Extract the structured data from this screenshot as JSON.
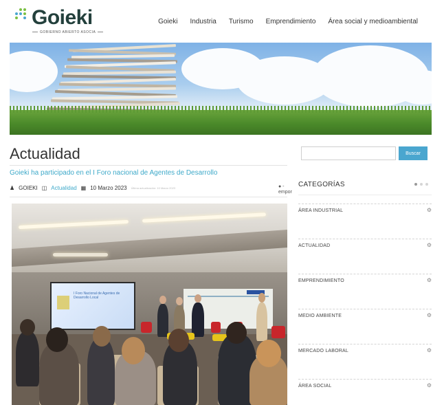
{
  "header": {
    "logo_text": "Goieki",
    "logo_sub": "GOBIERNO ABIERTO ASOCIA",
    "nav": [
      "Goieki",
      "Industria",
      "Turismo",
      "Emprendimiento",
      "Área social y medioambiental"
    ]
  },
  "main": {
    "page_title": "Actualidad",
    "post_title": "Goieki ha participado en el I Foro nacional de Agentes de Desarrollo",
    "meta": {
      "author": "GOIEKI",
      "category": "Actualidad",
      "date": "10 Marzo 2023",
      "updated": "Última actualización: 10 Marzo 2023"
    },
    "share_label": "empor",
    "slide_text": "I Foro Nacional de Agentes de Desarrollo Local"
  },
  "sidebar": {
    "search_placeholder": "",
    "search_button": "Buscar",
    "categories_title": "CATEGORÍAS",
    "categories": [
      "ÁREA INDUSTRIAL",
      "ACTUALIDAD",
      "EMPRENDIMIENTO",
      "MEDIO AMBIENTE",
      "MERCADO LABORAL",
      "ÁREA SOCIAL"
    ]
  },
  "colors": {
    "accent": "#4aa6cf",
    "link": "#3ea9c9",
    "logo": "#23403c"
  },
  "icons": {
    "author": "user-icon",
    "category": "folder-icon",
    "date": "calendar-icon",
    "category_item": "settings-icon"
  }
}
